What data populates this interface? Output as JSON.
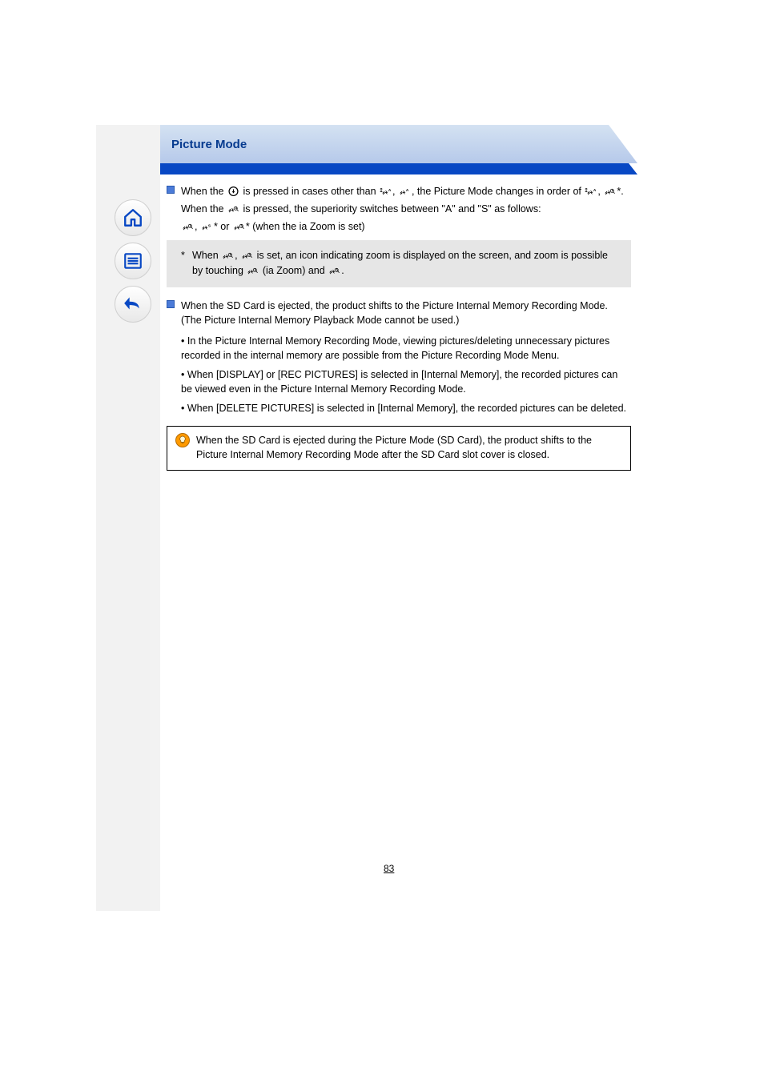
{
  "banner": {
    "title": "Picture Mode"
  },
  "block1": {
    "textA": "When the ",
    "textB": " is pressed in cases other than ",
    "textC": ", ",
    "textD": ", the Picture Mode changes in order of ",
    "textE": ", ",
    "textF": ".",
    "sub_leadA": "When the ",
    "sub_leadB": " is pressed, the superiority switches between \"A\" and \"S\" as follows:",
    "sub_row2A": ", ",
    "sub_row2B": " or ",
    "sub_row2C": " ",
    "sub_arrow": "(when the ia Zoom is set)",
    "sub_row2D": "",
    "asterisk_a": "When ",
    "asterisk_b": ", ",
    "asterisk_c": " is set, an icon indicating zoom is displayed on the screen, and zoom is possible by touching ",
    "asterisk_d": " (ia Zoom) and ",
    "asterisk_e": "."
  },
  "block2": {
    "textA": "When the SD Card is ejected, the product shifts to the Picture Internal Memory Recording Mode. (The Picture Internal Memory Playback Mode cannot be used.)",
    "subA": "In the Picture Internal Memory Recording Mode, viewing pictures/deleting unnecessary pictures recorded in the internal memory are possible from the Picture Recording Mode Menu.",
    "subB": "When [DISPLAY] or [REC PICTURES] is selected in [Internal Memory], the recorded pictures can be viewed even in the Picture Internal Memory Recording Mode.",
    "subC": "When [DELETE PICTURES] is selected in [Internal Memory], the recorded pictures can be deleted."
  },
  "tip": {
    "text": "When the SD Card is ejected during the Picture Mode (SD Card), the product shifts to the Picture Internal Memory Recording Mode after the SD Card slot cover is closed."
  },
  "pagenum": "83"
}
